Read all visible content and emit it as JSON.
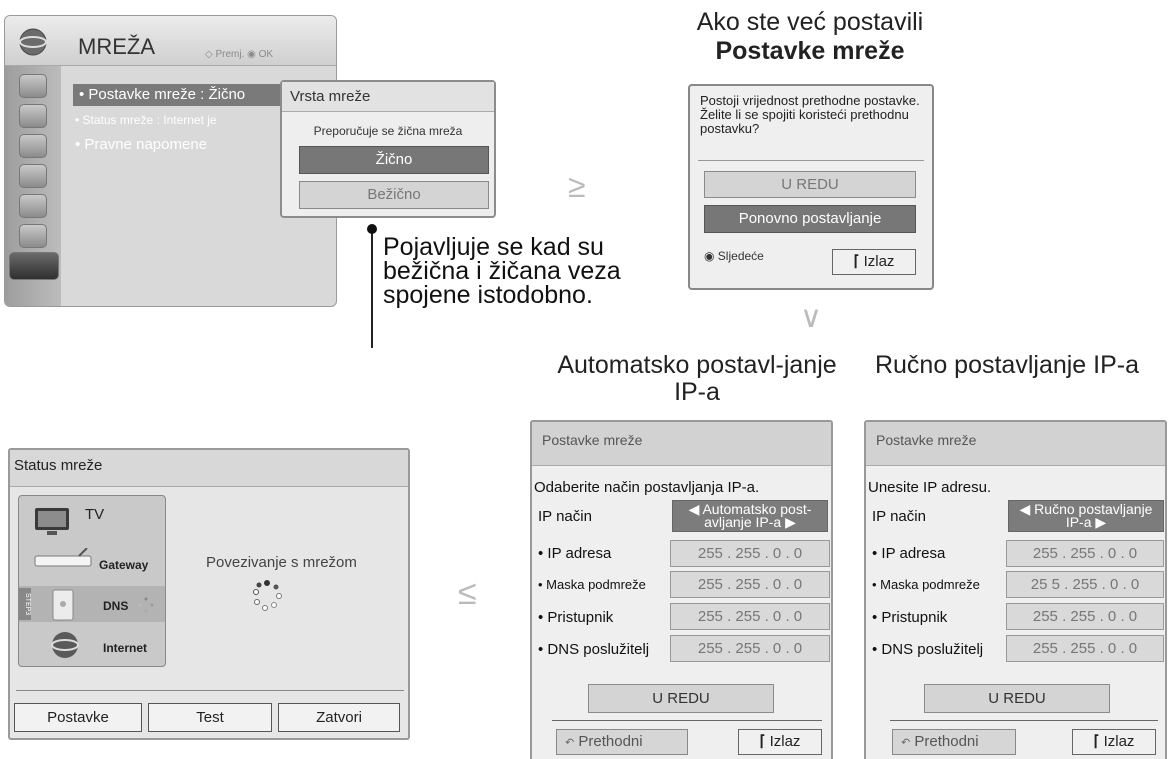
{
  "menu": {
    "title": "MREŽA",
    "hint": "◇ Premj. ◉ OK",
    "items": [
      {
        "label": "• Postavke mreže  : Žično"
      },
      {
        "label": "• Status mreže          : Internet je"
      },
      {
        "label": "• Pravne napomene"
      }
    ]
  },
  "network_type_popup": {
    "title": "Vrsta mreže",
    "recommendation": "Preporučuje se žična mreža",
    "options": [
      "Žično",
      "Bežično"
    ]
  },
  "note": {
    "lines": [
      "Pojavljuje se kad su",
      "bežična i žičana veza",
      "spojene istodobno."
    ]
  },
  "arrows": {
    "right": "≥",
    "down": "∨",
    "left": "≤"
  },
  "prev_setting": {
    "heading_line1": "Ako ste već postavili",
    "heading_line2": "Postavke mreže",
    "message": "Postoji vrijednost prethodne postavke. Želite li se spojiti koristeći prethodnu postavku?",
    "ok_label": "U REDU",
    "reset_label": "Ponovno postavljanje",
    "next_label": "◉ Sljedeće",
    "exit_label": "Izlaz"
  },
  "auto_ip": {
    "heading": "Automatsko postavl-janje IP-a",
    "panel_title": "Postavke mreže",
    "instruction": "Odaberite način postavljanja IP-a.",
    "mode_label": "IP način",
    "mode_value": "◀ Automatsko post-avljanje IP-a ▶",
    "fields": [
      {
        "label": "• IP adresa",
        "value": "255 . 255 . 0 . 0"
      },
      {
        "label": "• Maska podmreže",
        "value": "255 . 255 . 0 . 0"
      },
      {
        "label": "• Pristupnik",
        "value": "255 . 255 . 0 . 0"
      },
      {
        "label": "• DNS poslužitelj",
        "value": "255 . 255 . 0 . 0"
      }
    ],
    "ok_label": "U REDU",
    "prev_label": "Prethodni",
    "exit_label": "Izlaz"
  },
  "manual_ip": {
    "heading": "Ručno postavljanje IP-a",
    "panel_title": "Postavke mreže",
    "instruction": "Unesite IP adresu.",
    "mode_label": "IP način",
    "mode_value": "◀ Ručno postavljanje IP-a ▶",
    "fields": [
      {
        "label": "• IP adresa",
        "value": "255 . 255 . 0 . 0"
      },
      {
        "label": "• Maska podmreže",
        "value": "25 5 . 255 . 0 . 0"
      },
      {
        "label": "• Pristupnik",
        "value": "255 . 255 . 0 . 0"
      },
      {
        "label": "• DNS poslužitelj",
        "value": "255 . 255 . 0 . 0"
      }
    ],
    "ok_label": "U REDU",
    "prev_label": "Prethodni",
    "exit_label": "Izlaz"
  },
  "status": {
    "title": "Status mreže",
    "steps": {
      "tv": "TV",
      "gateway": "Gateway",
      "dns": "DNS",
      "internet": "Internet",
      "step_tag": "STEP3"
    },
    "connecting": "Povezivanje s mrežom",
    "buttons": [
      "Postavke",
      "Test",
      "Zatvori"
    ]
  }
}
